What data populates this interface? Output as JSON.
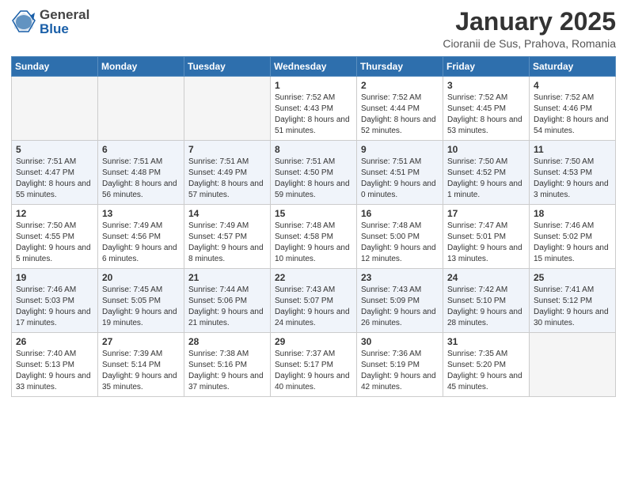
{
  "header": {
    "logo_general": "General",
    "logo_blue": "Blue",
    "title": "January 2025",
    "location": "Cioranii de Sus, Prahova, Romania"
  },
  "weekdays": [
    "Sunday",
    "Monday",
    "Tuesday",
    "Wednesday",
    "Thursday",
    "Friday",
    "Saturday"
  ],
  "weeks": [
    [
      {
        "day": "",
        "empty": true
      },
      {
        "day": "",
        "empty": true
      },
      {
        "day": "",
        "empty": true
      },
      {
        "day": "1",
        "sunrise": "7:52 AM",
        "sunset": "4:43 PM",
        "daylight": "8 hours and 51 minutes."
      },
      {
        "day": "2",
        "sunrise": "7:52 AM",
        "sunset": "4:44 PM",
        "daylight": "8 hours and 52 minutes."
      },
      {
        "day": "3",
        "sunrise": "7:52 AM",
        "sunset": "4:45 PM",
        "daylight": "8 hours and 53 minutes."
      },
      {
        "day": "4",
        "sunrise": "7:52 AM",
        "sunset": "4:46 PM",
        "daylight": "8 hours and 54 minutes."
      }
    ],
    [
      {
        "day": "5",
        "sunrise": "7:51 AM",
        "sunset": "4:47 PM",
        "daylight": "8 hours and 55 minutes."
      },
      {
        "day": "6",
        "sunrise": "7:51 AM",
        "sunset": "4:48 PM",
        "daylight": "8 hours and 56 minutes."
      },
      {
        "day": "7",
        "sunrise": "7:51 AM",
        "sunset": "4:49 PM",
        "daylight": "8 hours and 57 minutes."
      },
      {
        "day": "8",
        "sunrise": "7:51 AM",
        "sunset": "4:50 PM",
        "daylight": "8 hours and 59 minutes."
      },
      {
        "day": "9",
        "sunrise": "7:51 AM",
        "sunset": "4:51 PM",
        "daylight": "9 hours and 0 minutes."
      },
      {
        "day": "10",
        "sunrise": "7:50 AM",
        "sunset": "4:52 PM",
        "daylight": "9 hours and 1 minute."
      },
      {
        "day": "11",
        "sunrise": "7:50 AM",
        "sunset": "4:53 PM",
        "daylight": "9 hours and 3 minutes."
      }
    ],
    [
      {
        "day": "12",
        "sunrise": "7:50 AM",
        "sunset": "4:55 PM",
        "daylight": "9 hours and 5 minutes."
      },
      {
        "day": "13",
        "sunrise": "7:49 AM",
        "sunset": "4:56 PM",
        "daylight": "9 hours and 6 minutes."
      },
      {
        "day": "14",
        "sunrise": "7:49 AM",
        "sunset": "4:57 PM",
        "daylight": "9 hours and 8 minutes."
      },
      {
        "day": "15",
        "sunrise": "7:48 AM",
        "sunset": "4:58 PM",
        "daylight": "9 hours and 10 minutes."
      },
      {
        "day": "16",
        "sunrise": "7:48 AM",
        "sunset": "5:00 PM",
        "daylight": "9 hours and 12 minutes."
      },
      {
        "day": "17",
        "sunrise": "7:47 AM",
        "sunset": "5:01 PM",
        "daylight": "9 hours and 13 minutes."
      },
      {
        "day": "18",
        "sunrise": "7:46 AM",
        "sunset": "5:02 PM",
        "daylight": "9 hours and 15 minutes."
      }
    ],
    [
      {
        "day": "19",
        "sunrise": "7:46 AM",
        "sunset": "5:03 PM",
        "daylight": "9 hours and 17 minutes."
      },
      {
        "day": "20",
        "sunrise": "7:45 AM",
        "sunset": "5:05 PM",
        "daylight": "9 hours and 19 minutes."
      },
      {
        "day": "21",
        "sunrise": "7:44 AM",
        "sunset": "5:06 PM",
        "daylight": "9 hours and 21 minutes."
      },
      {
        "day": "22",
        "sunrise": "7:43 AM",
        "sunset": "5:07 PM",
        "daylight": "9 hours and 24 minutes."
      },
      {
        "day": "23",
        "sunrise": "7:43 AM",
        "sunset": "5:09 PM",
        "daylight": "9 hours and 26 minutes."
      },
      {
        "day": "24",
        "sunrise": "7:42 AM",
        "sunset": "5:10 PM",
        "daylight": "9 hours and 28 minutes."
      },
      {
        "day": "25",
        "sunrise": "7:41 AM",
        "sunset": "5:12 PM",
        "daylight": "9 hours and 30 minutes."
      }
    ],
    [
      {
        "day": "26",
        "sunrise": "7:40 AM",
        "sunset": "5:13 PM",
        "daylight": "9 hours and 33 minutes."
      },
      {
        "day": "27",
        "sunrise": "7:39 AM",
        "sunset": "5:14 PM",
        "daylight": "9 hours and 35 minutes."
      },
      {
        "day": "28",
        "sunrise": "7:38 AM",
        "sunset": "5:16 PM",
        "daylight": "9 hours and 37 minutes."
      },
      {
        "day": "29",
        "sunrise": "7:37 AM",
        "sunset": "5:17 PM",
        "daylight": "9 hours and 40 minutes."
      },
      {
        "day": "30",
        "sunrise": "7:36 AM",
        "sunset": "5:19 PM",
        "daylight": "9 hours and 42 minutes."
      },
      {
        "day": "31",
        "sunrise": "7:35 AM",
        "sunset": "5:20 PM",
        "daylight": "9 hours and 45 minutes."
      },
      {
        "day": "",
        "empty": true
      }
    ]
  ]
}
